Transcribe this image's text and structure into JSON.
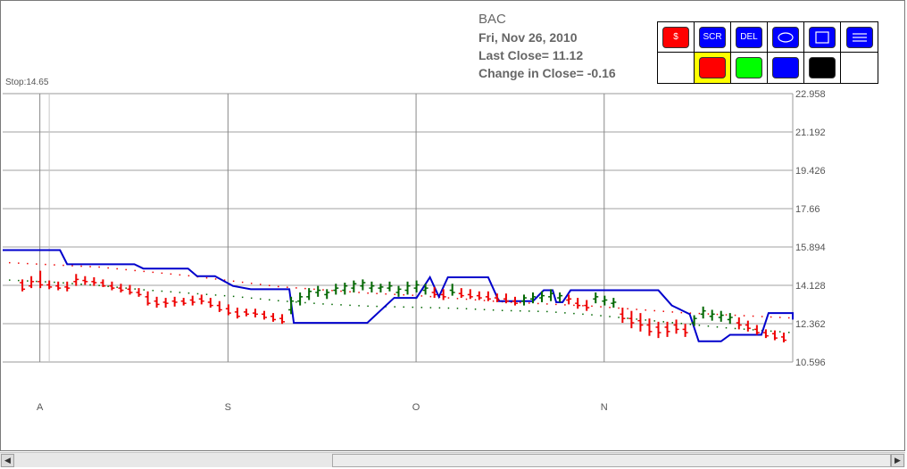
{
  "info": {
    "symbol": "BAC",
    "date": "Fri, Nov 26, 2010",
    "last_close": "Last Close=  11.12",
    "change": "Change in Close=  -0.16"
  },
  "stop_label": "Stop:14.65",
  "toolbar": {
    "buttons": [
      {
        "label": "$",
        "color": "#ff0000",
        "name": "dollar-button"
      },
      {
        "label": "SCR",
        "color": "#0000ff",
        "name": "scr-button"
      },
      {
        "label": "DEL",
        "color": "#0000ff",
        "name": "del-button"
      },
      {
        "label": "",
        "color": "#0000ff",
        "name": "ellipse-tool-button",
        "icon": "ellipse-icon"
      },
      {
        "label": "",
        "color": "#0000ff",
        "name": "rectangle-tool-button",
        "icon": "rectangle-icon"
      },
      {
        "label": "",
        "color": "#0000ff",
        "name": "lines-tool-button",
        "icon": "lines-icon"
      }
    ],
    "colors": [
      "#ff0000",
      "#00ff00",
      "#0000ff",
      "#000000"
    ],
    "selected_color": "#ff0000"
  },
  "chart_data": {
    "type": "bar",
    "symbol": "BAC",
    "y_ticks": [
      "22.958",
      "21.192",
      "19.426",
      "17.66",
      "15.894",
      "14.128",
      "12.362",
      "10.596"
    ],
    "ylim": [
      10.596,
      22.958
    ],
    "x_labels": [
      {
        "label": "A",
        "day": 2
      },
      {
        "label": "S",
        "day": 23
      },
      {
        "label": "O",
        "day": 44
      },
      {
        "label": "N",
        "day": 65
      }
    ],
    "x_range": [
      -2.2,
      86
    ],
    "grid": true,
    "colors": {
      "up": "#006600",
      "down": "#ee0000",
      "stop": "#0000cc"
    },
    "bars": [
      {
        "day": 0,
        "o": 14.25,
        "h": 14.4,
        "l": 13.85,
        "c": 13.95,
        "dir": "down"
      },
      {
        "day": 1,
        "o": 14.1,
        "h": 14.55,
        "l": 14.0,
        "c": 14.3,
        "dir": "down"
      },
      {
        "day": 2,
        "o": 14.3,
        "h": 14.8,
        "l": 14.0,
        "c": 14.15,
        "dir": "down"
      },
      {
        "day": 3,
        "o": 14.15,
        "h": 14.35,
        "l": 13.95,
        "c": 14.05,
        "dir": "down"
      },
      {
        "day": 4,
        "o": 14.1,
        "h": 14.3,
        "l": 13.9,
        "c": 14.0,
        "dir": "down"
      },
      {
        "day": 5,
        "o": 14.05,
        "h": 14.3,
        "l": 13.85,
        "c": 14.0,
        "dir": "down"
      },
      {
        "day": 6,
        "o": 14.3,
        "h": 14.65,
        "l": 14.1,
        "c": 14.4,
        "dir": "down"
      },
      {
        "day": 7,
        "o": 14.35,
        "h": 14.55,
        "l": 14.15,
        "c": 14.3,
        "dir": "down"
      },
      {
        "day": 8,
        "o": 14.3,
        "h": 14.5,
        "l": 14.1,
        "c": 14.25,
        "dir": "down"
      },
      {
        "day": 9,
        "o": 14.25,
        "h": 14.4,
        "l": 14.05,
        "c": 14.1,
        "dir": "down"
      },
      {
        "day": 10,
        "o": 14.1,
        "h": 14.3,
        "l": 13.9,
        "c": 14.0,
        "dir": "down"
      },
      {
        "day": 11,
        "o": 14.0,
        "h": 14.2,
        "l": 13.8,
        "c": 13.9,
        "dir": "down"
      },
      {
        "day": 12,
        "o": 13.95,
        "h": 14.15,
        "l": 13.7,
        "c": 13.8,
        "dir": "down"
      },
      {
        "day": 13,
        "o": 13.8,
        "h": 14.0,
        "l": 13.6,
        "c": 13.7,
        "dir": "down"
      },
      {
        "day": 14,
        "o": 13.6,
        "h": 13.85,
        "l": 13.2,
        "c": 13.3,
        "dir": "down"
      },
      {
        "day": 15,
        "o": 13.4,
        "h": 13.6,
        "l": 13.1,
        "c": 13.25,
        "dir": "down"
      },
      {
        "day": 16,
        "o": 13.35,
        "h": 13.55,
        "l": 13.1,
        "c": 13.3,
        "dir": "down"
      },
      {
        "day": 17,
        "o": 13.4,
        "h": 13.6,
        "l": 13.15,
        "c": 13.35,
        "dir": "down"
      },
      {
        "day": 18,
        "o": 13.4,
        "h": 13.55,
        "l": 13.2,
        "c": 13.3,
        "dir": "down"
      },
      {
        "day": 19,
        "o": 13.45,
        "h": 13.65,
        "l": 13.2,
        "c": 13.35,
        "dir": "down"
      },
      {
        "day": 20,
        "o": 13.5,
        "h": 13.7,
        "l": 13.25,
        "c": 13.4,
        "dir": "down"
      },
      {
        "day": 21,
        "o": 13.35,
        "h": 13.55,
        "l": 13.1,
        "c": 13.2,
        "dir": "down"
      },
      {
        "day": 22,
        "o": 13.2,
        "h": 13.4,
        "l": 12.9,
        "c": 13.0,
        "dir": "down"
      },
      {
        "day": 23,
        "o": 13.05,
        "h": 13.25,
        "l": 12.75,
        "c": 12.85,
        "dir": "down"
      },
      {
        "day": 24,
        "o": 12.9,
        "h": 13.1,
        "l": 12.6,
        "c": 12.7,
        "dir": "down"
      },
      {
        "day": 25,
        "o": 12.9,
        "h": 13.05,
        "l": 12.7,
        "c": 12.8,
        "dir": "down"
      },
      {
        "day": 26,
        "o": 12.85,
        "h": 13.05,
        "l": 12.65,
        "c": 12.8,
        "dir": "down"
      },
      {
        "day": 27,
        "o": 12.8,
        "h": 12.95,
        "l": 12.55,
        "c": 12.65,
        "dir": "down"
      },
      {
        "day": 28,
        "o": 12.7,
        "h": 12.85,
        "l": 12.45,
        "c": 12.55,
        "dir": "down"
      },
      {
        "day": 29,
        "o": 12.6,
        "h": 12.8,
        "l": 12.35,
        "c": 12.45,
        "dir": "down"
      },
      {
        "day": 30,
        "o": 13.0,
        "h": 13.6,
        "l": 12.8,
        "c": 13.4,
        "dir": "up"
      },
      {
        "day": 31,
        "o": 13.4,
        "h": 13.8,
        "l": 13.2,
        "c": 13.6,
        "dir": "up"
      },
      {
        "day": 32,
        "o": 13.6,
        "h": 14.0,
        "l": 13.45,
        "c": 13.85,
        "dir": "up"
      },
      {
        "day": 33,
        "o": 13.8,
        "h": 14.1,
        "l": 13.6,
        "c": 13.9,
        "dir": "up"
      },
      {
        "day": 34,
        "o": 13.7,
        "h": 13.95,
        "l": 13.5,
        "c": 13.8,
        "dir": "up"
      },
      {
        "day": 35,
        "o": 13.9,
        "h": 14.2,
        "l": 13.7,
        "c": 14.0,
        "dir": "up"
      },
      {
        "day": 36,
        "o": 13.9,
        "h": 14.25,
        "l": 13.7,
        "c": 14.1,
        "dir": "up"
      },
      {
        "day": 37,
        "o": 14.0,
        "h": 14.35,
        "l": 13.8,
        "c": 14.2,
        "dir": "up"
      },
      {
        "day": 38,
        "o": 14.1,
        "h": 14.4,
        "l": 13.9,
        "c": 14.25,
        "dir": "up"
      },
      {
        "day": 39,
        "o": 14.0,
        "h": 14.3,
        "l": 13.8,
        "c": 14.1,
        "dir": "up"
      },
      {
        "day": 40,
        "o": 14.0,
        "h": 14.2,
        "l": 13.8,
        "c": 14.05,
        "dir": "up"
      },
      {
        "day": 41,
        "o": 14.0,
        "h": 14.3,
        "l": 13.85,
        "c": 14.1,
        "dir": "up"
      },
      {
        "day": 42,
        "o": 13.8,
        "h": 14.1,
        "l": 13.6,
        "c": 13.95,
        "dir": "up"
      },
      {
        "day": 43,
        "o": 13.9,
        "h": 14.3,
        "l": 13.7,
        "c": 14.1,
        "dir": "up"
      },
      {
        "day": 44,
        "o": 14.0,
        "h": 14.35,
        "l": 13.8,
        "c": 14.15,
        "dir": "up"
      },
      {
        "day": 45,
        "o": 13.9,
        "h": 14.2,
        "l": 13.7,
        "c": 14.0,
        "dir": "up"
      },
      {
        "day": 46,
        "o": 13.8,
        "h": 14.05,
        "l": 13.55,
        "c": 13.7,
        "dir": "down"
      },
      {
        "day": 47,
        "o": 13.7,
        "h": 13.95,
        "l": 13.45,
        "c": 13.6,
        "dir": "down"
      },
      {
        "day": 48,
        "o": 13.9,
        "h": 14.2,
        "l": 13.65,
        "c": 13.8,
        "dir": "up"
      },
      {
        "day": 49,
        "o": 13.75,
        "h": 14.0,
        "l": 13.55,
        "c": 13.65,
        "dir": "down"
      },
      {
        "day": 50,
        "o": 13.7,
        "h": 13.95,
        "l": 13.5,
        "c": 13.6,
        "dir": "down"
      },
      {
        "day": 51,
        "o": 13.65,
        "h": 13.85,
        "l": 13.45,
        "c": 13.55,
        "dir": "down"
      },
      {
        "day": 52,
        "o": 13.6,
        "h": 13.85,
        "l": 13.4,
        "c": 13.5,
        "dir": "down"
      },
      {
        "day": 53,
        "o": 13.55,
        "h": 13.75,
        "l": 13.35,
        "c": 13.45,
        "dir": "down"
      },
      {
        "day": 54,
        "o": 13.5,
        "h": 13.75,
        "l": 13.3,
        "c": 13.4,
        "dir": "down"
      },
      {
        "day": 55,
        "o": 13.4,
        "h": 13.6,
        "l": 13.2,
        "c": 13.3,
        "dir": "down"
      },
      {
        "day": 56,
        "o": 13.4,
        "h": 13.7,
        "l": 13.2,
        "c": 13.55,
        "dir": "up"
      },
      {
        "day": 57,
        "o": 13.5,
        "h": 13.8,
        "l": 13.3,
        "c": 13.6,
        "dir": "up"
      },
      {
        "day": 58,
        "o": 13.55,
        "h": 13.85,
        "l": 13.35,
        "c": 13.65,
        "dir": "up"
      },
      {
        "day": 59,
        "o": 13.6,
        "h": 13.95,
        "l": 13.4,
        "c": 13.75,
        "dir": "up"
      },
      {
        "day": 60,
        "o": 13.55,
        "h": 13.8,
        "l": 13.35,
        "c": 13.65,
        "dir": "up"
      },
      {
        "day": 61,
        "o": 13.45,
        "h": 13.7,
        "l": 13.25,
        "c": 13.5,
        "dir": "down"
      },
      {
        "day": 62,
        "o": 13.3,
        "h": 13.55,
        "l": 13.05,
        "c": 13.2,
        "dir": "down"
      },
      {
        "day": 63,
        "o": 13.2,
        "h": 13.45,
        "l": 12.95,
        "c": 13.1,
        "dir": "down"
      },
      {
        "day": 64,
        "o": 13.5,
        "h": 13.8,
        "l": 13.3,
        "c": 13.6,
        "dir": "up"
      },
      {
        "day": 65,
        "o": 13.4,
        "h": 13.65,
        "l": 13.2,
        "c": 13.45,
        "dir": "up"
      },
      {
        "day": 66,
        "o": 13.3,
        "h": 13.55,
        "l": 13.1,
        "c": 13.35,
        "dir": "up"
      },
      {
        "day": 67,
        "o": 12.8,
        "h": 13.1,
        "l": 12.4,
        "c": 12.6,
        "dir": "down"
      },
      {
        "day": 68,
        "o": 12.6,
        "h": 12.95,
        "l": 12.15,
        "c": 12.4,
        "dir": "down"
      },
      {
        "day": 69,
        "o": 12.5,
        "h": 12.85,
        "l": 12.0,
        "c": 12.3,
        "dir": "down"
      },
      {
        "day": 70,
        "o": 12.3,
        "h": 12.6,
        "l": 11.8,
        "c": 12.0,
        "dir": "down"
      },
      {
        "day": 71,
        "o": 12.2,
        "h": 12.45,
        "l": 11.7,
        "c": 11.95,
        "dir": "down"
      },
      {
        "day": 72,
        "o": 12.2,
        "h": 12.45,
        "l": 11.75,
        "c": 12.0,
        "dir": "down"
      },
      {
        "day": 73,
        "o": 12.3,
        "h": 12.55,
        "l": 11.9,
        "c": 12.1,
        "dir": "down"
      },
      {
        "day": 74,
        "o": 12.1,
        "h": 12.35,
        "l": 11.75,
        "c": 11.95,
        "dir": "down"
      },
      {
        "day": 75,
        "o": 12.4,
        "h": 12.75,
        "l": 12.25,
        "c": 12.6,
        "dir": "up"
      },
      {
        "day": 76,
        "o": 12.8,
        "h": 13.15,
        "l": 12.6,
        "c": 12.95,
        "dir": "up"
      },
      {
        "day": 77,
        "o": 12.7,
        "h": 13.0,
        "l": 12.5,
        "c": 12.8,
        "dir": "up"
      },
      {
        "day": 78,
        "o": 12.65,
        "h": 12.95,
        "l": 12.45,
        "c": 12.75,
        "dir": "up"
      },
      {
        "day": 79,
        "o": 12.55,
        "h": 12.85,
        "l": 12.35,
        "c": 12.65,
        "dir": "up"
      },
      {
        "day": 80,
        "o": 12.4,
        "h": 12.65,
        "l": 12.1,
        "c": 12.3,
        "dir": "down"
      },
      {
        "day": 81,
        "o": 12.3,
        "h": 12.5,
        "l": 12.0,
        "c": 12.15,
        "dir": "down"
      },
      {
        "day": 82,
        "o": 12.1,
        "h": 12.3,
        "l": 11.85,
        "c": 11.95,
        "dir": "down"
      },
      {
        "day": 83,
        "o": 11.95,
        "h": 12.1,
        "l": 11.7,
        "c": 11.8,
        "dir": "down"
      },
      {
        "day": 84,
        "o": 11.9,
        "h": 12.05,
        "l": 11.6,
        "c": 11.7,
        "dir": "down"
      },
      {
        "day": 85,
        "o": 11.75,
        "h": 11.95,
        "l": 11.5,
        "c": 11.6,
        "dir": "down"
      }
    ],
    "stop_line": [
      [
        -2.2,
        15.75
      ],
      [
        4.2,
        15.75
      ],
      [
        5,
        15.1
      ],
      [
        12.5,
        15.1
      ],
      [
        13.5,
        14.9
      ],
      [
        18.5,
        14.9
      ],
      [
        19.5,
        14.55
      ],
      [
        21.5,
        14.55
      ],
      [
        23.5,
        14.1
      ],
      [
        25.5,
        13.95
      ],
      [
        29.8,
        13.95
      ],
      [
        30.3,
        12.4
      ],
      [
        38.5,
        12.4
      ],
      [
        41.5,
        13.55
      ],
      [
        44,
        13.55
      ],
      [
        45.5,
        14.5
      ],
      [
        46.5,
        13.6
      ],
      [
        47.5,
        14.5
      ],
      [
        52,
        14.5
      ],
      [
        53.2,
        13.4
      ],
      [
        57,
        13.4
      ],
      [
        58.2,
        13.9
      ],
      [
        59.2,
        13.9
      ],
      [
        59.6,
        13.35
      ],
      [
        60.3,
        13.35
      ],
      [
        61.2,
        13.9
      ],
      [
        71,
        13.9
      ],
      [
        72.5,
        13.2
      ],
      [
        74.5,
        12.8
      ],
      [
        75.5,
        11.55
      ],
      [
        78,
        11.55
      ],
      [
        79,
        11.85
      ],
      [
        82.5,
        11.85
      ],
      [
        83.3,
        12.85
      ],
      [
        87,
        12.85
      ],
      [
        88.5,
        12.6
      ],
      [
        89,
        12.55
      ]
    ],
    "upper_dots": [
      [
        -1.5,
        15.2
      ],
      [
        3.5,
        15.1
      ],
      [
        8.5,
        15.0
      ],
      [
        13.5,
        14.8
      ],
      [
        18.5,
        14.6
      ],
      [
        23.5,
        14.35
      ],
      [
        28.5,
        14.1
      ],
      [
        33.5,
        13.95
      ],
      [
        38.5,
        13.8
      ],
      [
        43.5,
        13.7
      ],
      [
        48.5,
        13.55
      ],
      [
        53.5,
        13.4
      ],
      [
        58.5,
        13.3
      ],
      [
        63.5,
        13.2
      ],
      [
        68.5,
        13.05
      ],
      [
        73.5,
        12.9
      ],
      [
        78.5,
        12.8
      ],
      [
        83.5,
        12.7
      ],
      [
        88.5,
        12.6
      ]
    ],
    "lower_dots": [
      [
        -1.5,
        14.4
      ],
      [
        3.5,
        14.3
      ],
      [
        8.5,
        14.15
      ],
      [
        13.5,
        13.95
      ],
      [
        18.5,
        13.8
      ],
      [
        23.5,
        13.65
      ],
      [
        28.5,
        13.45
      ],
      [
        33.5,
        13.3
      ],
      [
        38.5,
        13.2
      ],
      [
        43.5,
        13.15
      ],
      [
        48.5,
        13.1
      ],
      [
        53.5,
        13.0
      ],
      [
        58.5,
        12.95
      ],
      [
        63.5,
        12.8
      ],
      [
        68.5,
        12.6
      ],
      [
        73.5,
        12.4
      ],
      [
        78.5,
        12.2
      ],
      [
        83.5,
        12.05
      ],
      [
        88.5,
        11.9
      ]
    ]
  }
}
